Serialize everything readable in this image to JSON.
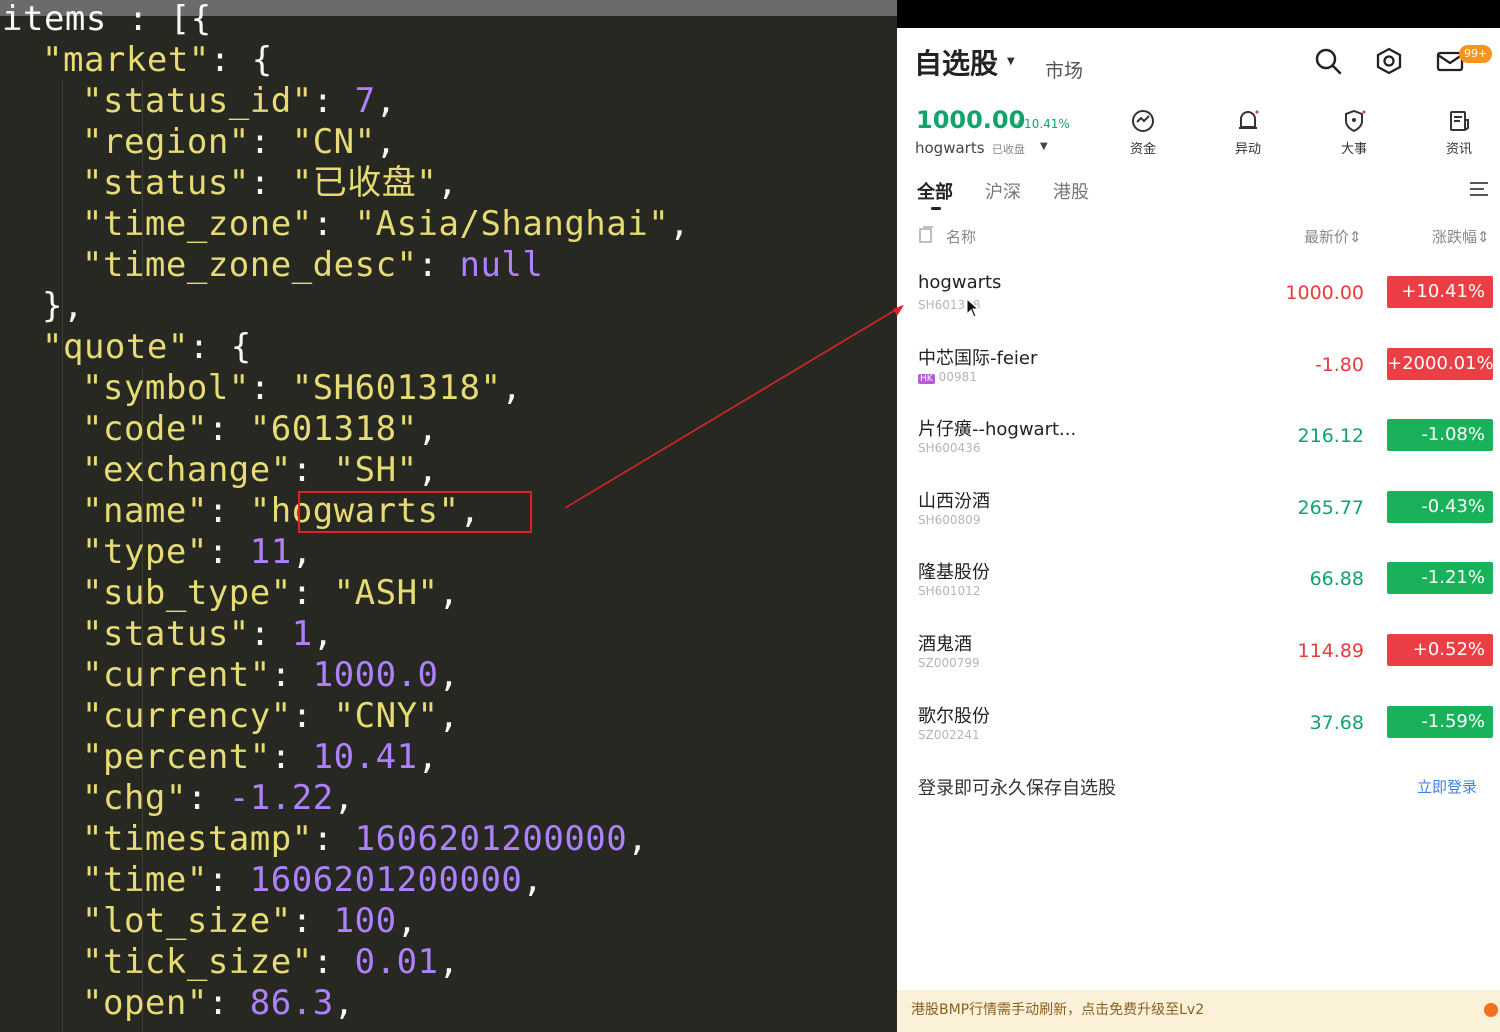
{
  "editor": {
    "lines": [
      {
        "indent": 0,
        "tokens": [
          {
            "t": "items",
            "c": "p"
          },
          {
            "t": " : [{",
            "c": "p"
          }
        ]
      },
      {
        "indent": 2,
        "tokens": [
          {
            "t": "\"market\"",
            "c": "k"
          },
          {
            "t": ": {",
            "c": "p"
          }
        ]
      },
      {
        "indent": 4,
        "tokens": [
          {
            "t": "\"status_id\"",
            "c": "k"
          },
          {
            "t": ": ",
            "c": "p"
          },
          {
            "t": "7",
            "c": "n"
          },
          {
            "t": ",",
            "c": "p"
          }
        ]
      },
      {
        "indent": 4,
        "tokens": [
          {
            "t": "\"region\"",
            "c": "k"
          },
          {
            "t": ": ",
            "c": "p"
          },
          {
            "t": "\"CN\"",
            "c": "k"
          },
          {
            "t": ",",
            "c": "p"
          }
        ]
      },
      {
        "indent": 4,
        "tokens": [
          {
            "t": "\"status\"",
            "c": "k"
          },
          {
            "t": ": ",
            "c": "p"
          },
          {
            "t": "\"已收盘\"",
            "c": "k"
          },
          {
            "t": ",",
            "c": "p"
          }
        ]
      },
      {
        "indent": 4,
        "tokens": [
          {
            "t": "\"time_zone\"",
            "c": "k"
          },
          {
            "t": ": ",
            "c": "p"
          },
          {
            "t": "\"Asia/Shanghai\"",
            "c": "k"
          },
          {
            "t": ",",
            "c": "p"
          }
        ]
      },
      {
        "indent": 4,
        "tokens": [
          {
            "t": "\"time_zone_desc\"",
            "c": "k"
          },
          {
            "t": ": ",
            "c": "p"
          },
          {
            "t": "null",
            "c": "n"
          }
        ]
      },
      {
        "indent": 2,
        "tokens": [
          {
            "t": "},",
            "c": "p"
          }
        ]
      },
      {
        "indent": 2,
        "tokens": [
          {
            "t": "\"quote\"",
            "c": "k"
          },
          {
            "t": ": {",
            "c": "p"
          }
        ]
      },
      {
        "indent": 4,
        "tokens": [
          {
            "t": "\"symbol\"",
            "c": "k"
          },
          {
            "t": ": ",
            "c": "p"
          },
          {
            "t": "\"SH601318\"",
            "c": "k"
          },
          {
            "t": ",",
            "c": "p"
          }
        ]
      },
      {
        "indent": 4,
        "tokens": [
          {
            "t": "\"code\"",
            "c": "k"
          },
          {
            "t": ": ",
            "c": "p"
          },
          {
            "t": "\"601318\"",
            "c": "k"
          },
          {
            "t": ",",
            "c": "p"
          }
        ]
      },
      {
        "indent": 4,
        "tokens": [
          {
            "t": "\"exchange\"",
            "c": "k"
          },
          {
            "t": ": ",
            "c": "p"
          },
          {
            "t": "\"SH\"",
            "c": "k"
          },
          {
            "t": ",",
            "c": "p"
          }
        ]
      },
      {
        "indent": 4,
        "tokens": [
          {
            "t": "\"name\"",
            "c": "k"
          },
          {
            "t": ": ",
            "c": "p"
          },
          {
            "t": "\"hogwarts\"",
            "c": "k"
          },
          {
            "t": ",",
            "c": "p"
          }
        ]
      },
      {
        "indent": 4,
        "tokens": [
          {
            "t": "\"type\"",
            "c": "k"
          },
          {
            "t": ": ",
            "c": "p"
          },
          {
            "t": "11",
            "c": "n"
          },
          {
            "t": ",",
            "c": "p"
          }
        ]
      },
      {
        "indent": 4,
        "tokens": [
          {
            "t": "\"sub_type\"",
            "c": "k"
          },
          {
            "t": ": ",
            "c": "p"
          },
          {
            "t": "\"ASH\"",
            "c": "k"
          },
          {
            "t": ",",
            "c": "p"
          }
        ]
      },
      {
        "indent": 4,
        "tokens": [
          {
            "t": "\"status\"",
            "c": "k"
          },
          {
            "t": ": ",
            "c": "p"
          },
          {
            "t": "1",
            "c": "n"
          },
          {
            "t": ",",
            "c": "p"
          }
        ]
      },
      {
        "indent": 4,
        "tokens": [
          {
            "t": "\"current\"",
            "c": "k"
          },
          {
            "t": ": ",
            "c": "p"
          },
          {
            "t": "1000.0",
            "c": "n"
          },
          {
            "t": ",",
            "c": "p"
          }
        ]
      },
      {
        "indent": 4,
        "tokens": [
          {
            "t": "\"currency\"",
            "c": "k"
          },
          {
            "t": ": ",
            "c": "p"
          },
          {
            "t": "\"CNY\"",
            "c": "k"
          },
          {
            "t": ",",
            "c": "p"
          }
        ]
      },
      {
        "indent": 4,
        "tokens": [
          {
            "t": "\"percent\"",
            "c": "k"
          },
          {
            "t": ": ",
            "c": "p"
          },
          {
            "t": "10.41",
            "c": "n"
          },
          {
            "t": ",",
            "c": "p"
          }
        ]
      },
      {
        "indent": 4,
        "tokens": [
          {
            "t": "\"chg\"",
            "c": "k"
          },
          {
            "t": ": ",
            "c": "p"
          },
          {
            "t": "-1.22",
            "c": "n"
          },
          {
            "t": ",",
            "c": "p"
          }
        ]
      },
      {
        "indent": 4,
        "tokens": [
          {
            "t": "\"timestamp\"",
            "c": "k"
          },
          {
            "t": ": ",
            "c": "p"
          },
          {
            "t": "1606201200000",
            "c": "n"
          },
          {
            "t": ",",
            "c": "p"
          }
        ]
      },
      {
        "indent": 4,
        "tokens": [
          {
            "t": "\"time\"",
            "c": "k"
          },
          {
            "t": ": ",
            "c": "p"
          },
          {
            "t": "1606201200000",
            "c": "n"
          },
          {
            "t": ",",
            "c": "p"
          }
        ]
      },
      {
        "indent": 4,
        "tokens": [
          {
            "t": "\"lot_size\"",
            "c": "k"
          },
          {
            "t": ": ",
            "c": "p"
          },
          {
            "t": "100",
            "c": "n"
          },
          {
            "t": ",",
            "c": "p"
          }
        ]
      },
      {
        "indent": 4,
        "tokens": [
          {
            "t": "\"tick_size\"",
            "c": "k"
          },
          {
            "t": ": ",
            "c": "p"
          },
          {
            "t": "0.01",
            "c": "n"
          },
          {
            "t": ",",
            "c": "p"
          }
        ]
      },
      {
        "indent": 4,
        "tokens": [
          {
            "t": "\"open\"",
            "c": "k"
          },
          {
            "t": ": ",
            "c": "p"
          },
          {
            "t": "86.3",
            "c": "n"
          },
          {
            "t": ",",
            "c": "p"
          }
        ]
      }
    ]
  },
  "app": {
    "title": "自选股",
    "market_tab": "市场",
    "notification_badge": "99+",
    "index": {
      "value": "1000.00",
      "percent": "+10.41%",
      "name": "hogwarts",
      "status": "已收盘"
    },
    "tools": [
      {
        "label": "资金",
        "icon": "fund-flow-icon"
      },
      {
        "label": "异动",
        "icon": "alert-bell-icon"
      },
      {
        "label": "大事",
        "icon": "shield-event-icon"
      },
      {
        "label": "资讯",
        "icon": "news-icon"
      }
    ],
    "tabs": [
      "全部",
      "沪深",
      "港股"
    ],
    "columns": {
      "name": "名称",
      "price": "最新价",
      "change": "涨跌幅"
    },
    "stocks": [
      {
        "name": "hogwarts",
        "code": "SH601318",
        "price": "1000.00",
        "change": "+10.41%",
        "direction": "up",
        "hk": false
      },
      {
        "name": "中芯国际-feier",
        "code": "00981",
        "price": "-1.80",
        "change": "+2000.01%",
        "direction": "up",
        "hk": true
      },
      {
        "name": "片仔癀--hogwart...",
        "code": "SH600436",
        "price": "216.12",
        "change": "-1.08%",
        "direction": "down",
        "hk": false
      },
      {
        "name": "山西汾酒",
        "code": "SH600809",
        "price": "265.77",
        "change": "-0.43%",
        "direction": "down",
        "hk": false
      },
      {
        "name": "隆基股份",
        "code": "SH601012",
        "price": "66.88",
        "change": "-1.21%",
        "direction": "down",
        "hk": false
      },
      {
        "name": "酒鬼酒",
        "code": "SZ000799",
        "price": "114.89",
        "change": "+0.52%",
        "direction": "up",
        "hk": false
      },
      {
        "name": "歌尔股份",
        "code": "SZ002241",
        "price": "37.68",
        "change": "-1.59%",
        "direction": "down",
        "hk": false
      }
    ],
    "hk_tag": "HK",
    "login_prompt": "登录即可永久保存自选股",
    "login_link": "立即登录",
    "banner": "港股BMP行情需手动刷新，点击免费升级至Lv2"
  },
  "colors": {
    "up": "#ec3e45",
    "down": "#19b25a",
    "accent_green": "#12a36b",
    "highlight": "#e0202a"
  }
}
